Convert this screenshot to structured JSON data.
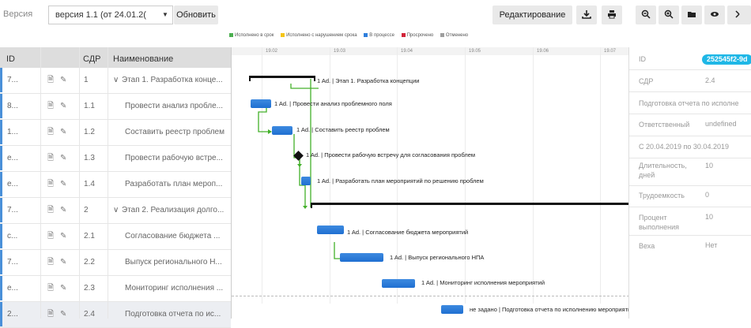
{
  "toolbar": {
    "version_label": "Версия",
    "version_value": "версия 1.1 (от 24.01.2(",
    "refresh_label": "Обновить",
    "edit_label": "Редактирование"
  },
  "legend": [
    {
      "label": "Исполнено в срок",
      "color": "#4caf50"
    },
    {
      "label": "Исполнено с нарушением срока",
      "color": "#f5c518"
    },
    {
      "label": "В процессе",
      "color": "#2f7fdc"
    },
    {
      "label": "Просрочено",
      "color": "#d2243a"
    },
    {
      "label": "Отменено",
      "color": "#9e9e9e"
    }
  ],
  "grid": {
    "headers": {
      "id": "ID",
      "wbs": "СДР",
      "name": "Наименование"
    },
    "rows": [
      {
        "id": "7...",
        "wbs": "1",
        "name": "Этап 1. Разработка конце...",
        "expand": "∨"
      },
      {
        "id": "8...",
        "wbs": "1.1",
        "name": "Провести анализ пробле...",
        "expand": ""
      },
      {
        "id": "1...",
        "wbs": "1.2",
        "name": "Составить реестр проблем",
        "expand": ""
      },
      {
        "id": "e...",
        "wbs": "1.3",
        "name": "Провести рабочую встре...",
        "expand": ""
      },
      {
        "id": "e...",
        "wbs": "1.4",
        "name": "Разработать план мероп...",
        "expand": ""
      },
      {
        "id": "7...",
        "wbs": "2",
        "name": "Этап 2. Реализация долго...",
        "expand": "∨"
      },
      {
        "id": "c...",
        "wbs": "2.1",
        "name": "Согласование бюджета ...",
        "expand": ""
      },
      {
        "id": "7...",
        "wbs": "2.2",
        "name": "Выпуск регионального Н...",
        "expand": ""
      },
      {
        "id": "e...",
        "wbs": "2.3",
        "name": "Мониторинг исполнения ...",
        "expand": ""
      },
      {
        "id": "2...",
        "wbs": "2.4",
        "name": "Подготовка отчета по ис...",
        "expand": ""
      }
    ]
  },
  "gantt": {
    "dates": [
      "19.02",
      "19.03",
      "19.04",
      "19.05",
      "19.06",
      "19.07"
    ],
    "labels": [
      "1 Ad. | Этап 1. Разработка концепции",
      "1 Ad. | Провести анализ проблемного поля",
      "1 Ad. | Составить реестр проблем",
      "1 Ad. | Провести рабочую встречу для согласования проблем",
      "1 Ad. | Разработать план мероприятий по решению проблем",
      "1 Ad. | Согласование бюджета мероприятий",
      "1 Ad. | Выпуск регионального НПА",
      "1 Ad. | Мониторинг исполнения мероприятий",
      "не задано | Подготовка отчета по исполнению мероприятий"
    ]
  },
  "details": {
    "id_label": "ID",
    "id_value": "252545f2-9d",
    "wbs_label": "СДР",
    "wbs_value": "2.4",
    "task_name": "Подготовка отчета по исполне",
    "responsible_label": "Ответственный",
    "responsible_value": "undefined",
    "period": "С 20.04.2019 по 30.04.2019",
    "duration_label": "Длительность, дней",
    "duration_value": "10",
    "labor_label": "Трудоемкость",
    "labor_value": "0",
    "percent_label": "Процент выполнения",
    "percent_value": "10",
    "milestone_label": "Веха",
    "milestone_value": "Нет"
  }
}
